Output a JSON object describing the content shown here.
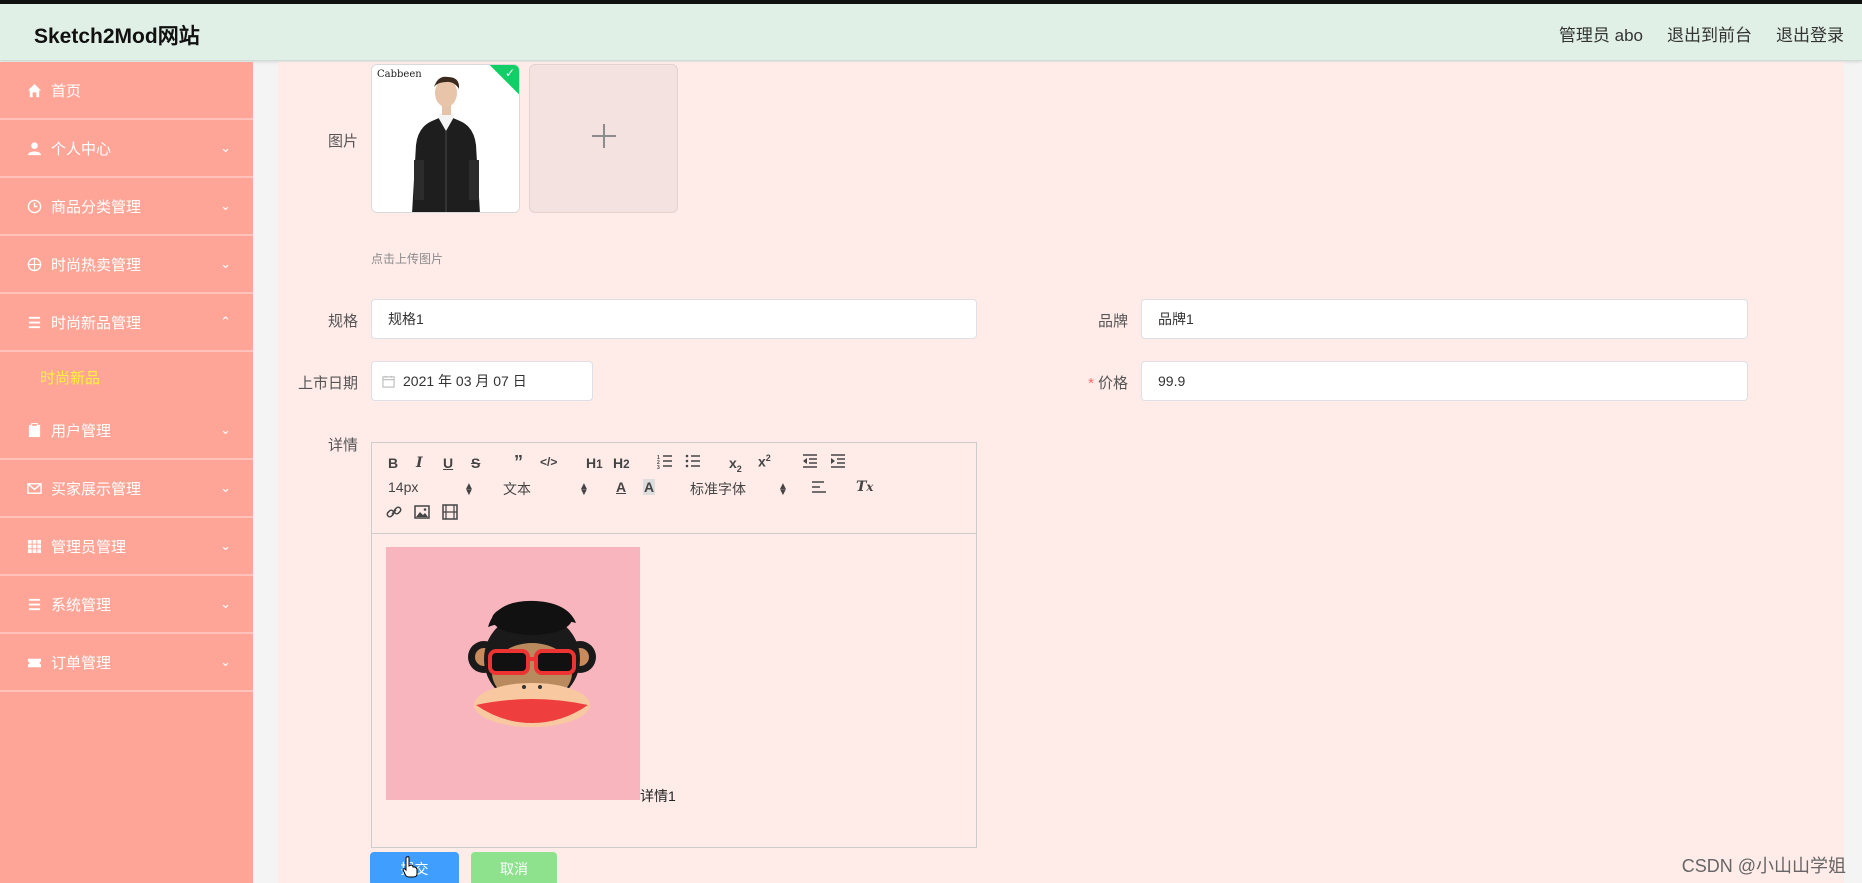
{
  "header": {
    "brand": "Sketch2Mod网站",
    "user": "管理员 abo",
    "front": "退出到前台",
    "logout": "退出登录"
  },
  "sidebar": {
    "items": [
      {
        "label": "首页",
        "icon": "home-icon"
      },
      {
        "label": "个人中心",
        "icon": "user-icon"
      },
      {
        "label": "商品分类管理",
        "icon": "clock-icon"
      },
      {
        "label": "时尚热卖管理",
        "icon": "target-icon"
      },
      {
        "label": "时尚新品管理",
        "icon": "list-icon"
      },
      {
        "label": "用户管理",
        "icon": "clipboard-icon"
      },
      {
        "label": "买家展示管理",
        "icon": "mail-icon"
      },
      {
        "label": "管理员管理",
        "icon": "grid-icon"
      },
      {
        "label": "系统管理",
        "icon": "list-icon"
      },
      {
        "label": "订单管理",
        "icon": "ticket-icon"
      }
    ],
    "sub_active": "时尚新品"
  },
  "form": {
    "image_label": "图片",
    "thumb_brand": "Cabbeen",
    "upload_tip": "点击上传图片",
    "spec_label": "规格",
    "spec_value": "规格1",
    "brand_label": "品牌",
    "brand_value": "品牌1",
    "date_label": "上市日期",
    "date_value": "2021 年 03 月 07 日",
    "price_label": "价格",
    "price_required": "*",
    "price_value": "99.9",
    "detail_label": "详情",
    "detail_text": "详情1"
  },
  "editor": {
    "font_size": "14px",
    "header_select": "文本",
    "font_family": "标准字体"
  },
  "buttons": {
    "submit": "提交",
    "cancel": "取消"
  },
  "colors": {
    "sidebar": "#ffa597",
    "main": "#ffece9",
    "header": "#e1f0e6",
    "primary": "#409eff",
    "cancel": "#8ee28e",
    "active_sub": "#fff23a"
  },
  "watermark": "CSDN @小山山学姐"
}
